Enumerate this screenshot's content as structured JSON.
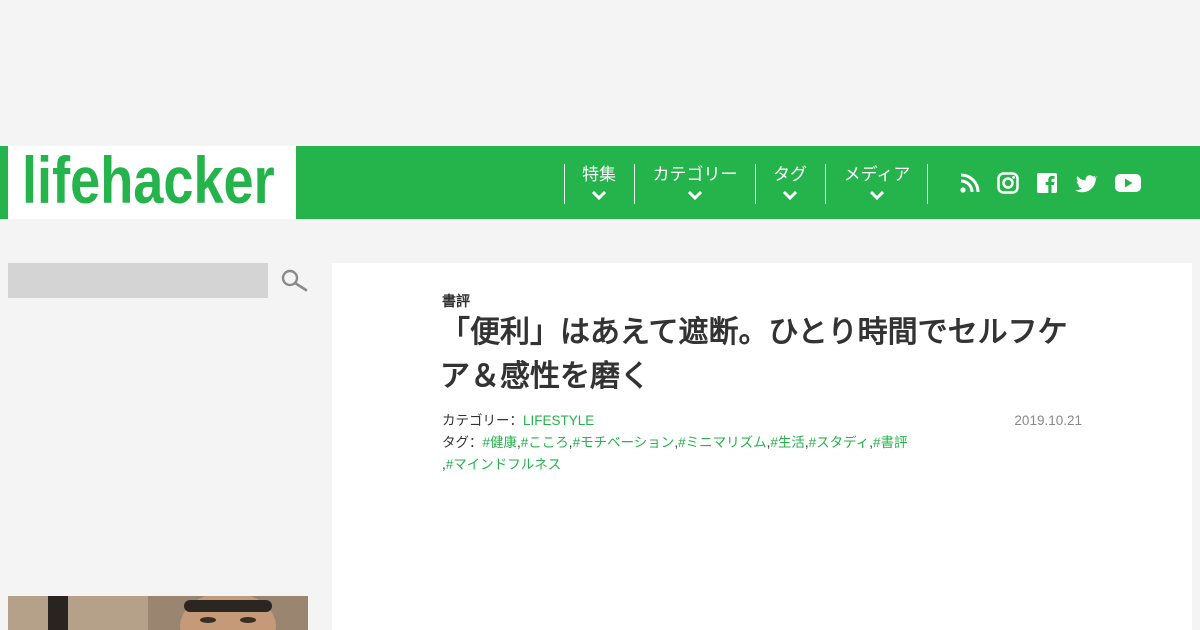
{
  "header": {
    "logo": "lifehacker",
    "nav": [
      {
        "label": "特集"
      },
      {
        "label": "カテゴリー"
      },
      {
        "label": "タグ"
      },
      {
        "label": "メディア"
      }
    ],
    "social_icons": [
      "rss-icon",
      "instagram-icon",
      "facebook-icon",
      "twitter-icon",
      "youtube-icon"
    ],
    "colors": {
      "brand": "#25b34b"
    }
  },
  "sidebar": {
    "search": {
      "value": "",
      "placeholder": ""
    },
    "search_icon": "search-icon"
  },
  "article": {
    "category_label": "書評",
    "title": "「便利」はあえて遮断。ひとり時間でセルフケア＆感性を磨く",
    "category_prefix": "カテゴリー：",
    "category": "LIFESTYLE",
    "tag_prefix": "タグ：",
    "tags": [
      "#健康",
      "#こころ",
      "#モチベーション",
      "#ミニマリズム",
      "#生活",
      "#スタディ",
      "#書評",
      "#マインドフルネス"
    ],
    "date": "2019.10.21"
  }
}
